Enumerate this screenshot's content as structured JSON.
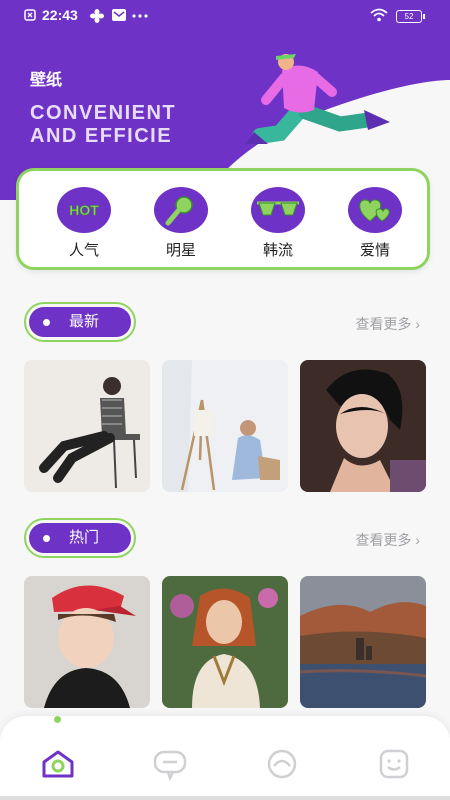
{
  "status_bar": {
    "time": "22:43",
    "battery": "52"
  },
  "header": {
    "title": "壁纸",
    "subtitle_line1": "CONVENIENT",
    "subtitle_line2": "AND EFFICIE"
  },
  "categories": [
    {
      "label": "人气",
      "icon": "hot-icon"
    },
    {
      "label": "明星",
      "icon": "microphone-icon"
    },
    {
      "label": "韩流",
      "icon": "sunglasses-icon"
    },
    {
      "label": "爱情",
      "icon": "hearts-icon"
    }
  ],
  "sections": {
    "latest": {
      "label": "最新",
      "more": "查看更多 ›"
    },
    "hot": {
      "label": "热门",
      "more": "查看更多 ›"
    }
  },
  "colors": {
    "primary": "#6f32c6",
    "accent": "#8fd460"
  }
}
